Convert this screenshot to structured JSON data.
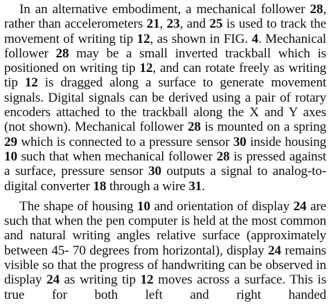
{
  "document": {
    "paragraph_1": [
      {
        "t": "In an alternative embodiment, a mechanical follower "
      },
      {
        "t": "28",
        "b": true
      },
      {
        "t": ", rather than accelerometers "
      },
      {
        "t": "21",
        "b": true
      },
      {
        "t": ", "
      },
      {
        "t": "23",
        "b": true
      },
      {
        "t": ", and "
      },
      {
        "t": "25",
        "b": true
      },
      {
        "t": " is used to track the movement of writing tip "
      },
      {
        "t": "12",
        "b": true
      },
      {
        "t": ", as shown in FIG. "
      },
      {
        "t": "4",
        "b": true
      },
      {
        "t": ". Mechanical follower "
      },
      {
        "t": "28",
        "b": true
      },
      {
        "t": " may be a small inverted trackball which is positioned on writing tip "
      },
      {
        "t": "12",
        "b": true
      },
      {
        "t": ", and can rotate freely as writing tip "
      },
      {
        "t": "12",
        "b": true
      },
      {
        "t": " is dragged along a surface to generate movement signals. Digital signals can be derived using a pair of rotary encoders attached to the trackball along the X and Y axes (not shown). Mechanical follower "
      },
      {
        "t": "28",
        "b": true
      },
      {
        "t": " is mounted on a spring "
      },
      {
        "t": "29",
        "b": true
      },
      {
        "t": " which is connected to a pressure sensor "
      },
      {
        "t": "30",
        "b": true
      },
      {
        "t": " inside housing "
      },
      {
        "t": "10",
        "b": true
      },
      {
        "t": " such that when mechanical follower "
      },
      {
        "t": "28",
        "b": true
      },
      {
        "t": " is pressed against a surface, pressure sensor "
      },
      {
        "t": "30",
        "b": true
      },
      {
        "t": " outputs a signal to analog-to-digital converter "
      },
      {
        "t": "18",
        "b": true
      },
      {
        "t": " through a wire "
      },
      {
        "t": "31",
        "b": true
      },
      {
        "t": "."
      }
    ],
    "paragraph_2": [
      {
        "t": "The shape of housing "
      },
      {
        "t": "10",
        "b": true
      },
      {
        "t": " and orientation of display "
      },
      {
        "t": "24",
        "b": true
      },
      {
        "t": " are such that when the pen computer is held at the most common and natural writing angles relative surface (approximately between 45- 70 degrees from horizontal), display "
      },
      {
        "t": "24",
        "b": true
      },
      {
        "t": " remains visible so that the progress of handwriting can be observed in display "
      },
      {
        "t": "24",
        "b": true
      },
      {
        "t": " as writing tip "
      },
      {
        "t": "12",
        "b": true
      },
      {
        "t": " moves across a surface. This is true for both left and right handed"
      }
    ]
  }
}
